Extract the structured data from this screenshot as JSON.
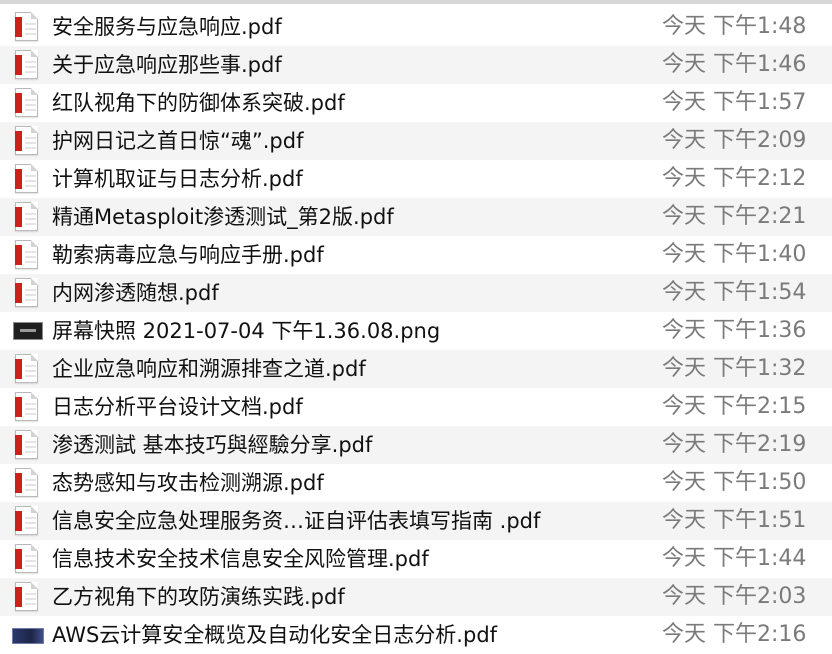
{
  "files": [
    {
      "name": "安全服务与应急响应.pdf",
      "date": "今天 下午1:48",
      "icon": "pdf-icon"
    },
    {
      "name": "关于应急响应那些事.pdf",
      "date": "今天 下午1:46",
      "icon": "pdf-icon"
    },
    {
      "name": "红队视角下的防御体系突破.pdf",
      "date": "今天 下午1:57",
      "icon": "pdf-icon"
    },
    {
      "name": "护网日记之首日惊“魂”.pdf",
      "date": "今天 下午2:09",
      "icon": "pdf-icon"
    },
    {
      "name": "计算机取证与日志分析.pdf",
      "date": "今天 下午2:12",
      "icon": "pdf-icon"
    },
    {
      "name": "精通Metasploit渗透测试_第2版.pdf",
      "date": "今天 下午2:21",
      "icon": "pdf-icon"
    },
    {
      "name": "勒索病毒应急与响应手册.pdf",
      "date": "今天 下午1:40",
      "icon": "pdf-icon"
    },
    {
      "name": "内网渗透随想.pdf",
      "date": "今天 下午1:54",
      "icon": "pdf-icon"
    },
    {
      "name": "屏幕快照 2021-07-04 下午1.36.08.png",
      "date": "今天 下午1:36",
      "icon": "png-icon"
    },
    {
      "name": "企业应急响应和溯源排查之道.pdf",
      "date": "今天 下午1:32",
      "icon": "pdf-icon"
    },
    {
      "name": "日志分析平台设计文档.pdf",
      "date": "今天 下午2:15",
      "icon": "pdf-icon"
    },
    {
      "name": "渗透测試 基本技巧與經驗分享.pdf",
      "date": "今天 下午2:19",
      "icon": "pdf-icon"
    },
    {
      "name": "态势感知与攻击检测溯源.pdf",
      "date": "今天 下午1:50",
      "icon": "pdf-icon"
    },
    {
      "name": "信息安全应急处理服务资…证自评估表填写指南 .pdf",
      "date": "今天 下午1:51",
      "icon": "pdf-icon"
    },
    {
      "name": "信息技术安全技术信息安全风险管理.pdf",
      "date": "今天 下午1:44",
      "icon": "pdf-icon"
    },
    {
      "name": "乙方视角下的攻防演练实践.pdf",
      "date": "今天 下午2:03",
      "icon": "pdf-icon"
    },
    {
      "name": "AWS云计算安全概览及自动化安全日志分析.pdf",
      "date": "今天 下午2:16",
      "icon": "pdf-thumb-icon"
    }
  ]
}
